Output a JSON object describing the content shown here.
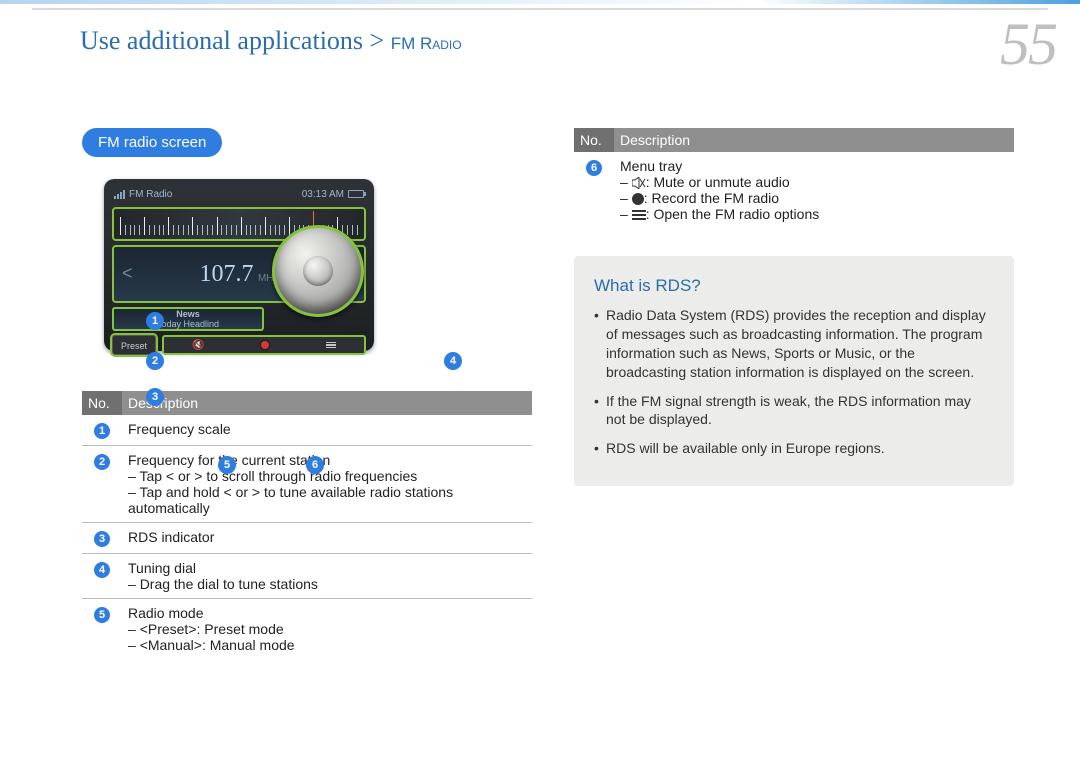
{
  "page": {
    "number": "55",
    "breadcrumb_main": "Use additional applications",
    "breadcrumb_sub": "FM Radio"
  },
  "left": {
    "section_label": "FM radio screen",
    "device": {
      "title": "FM Radio",
      "clock": "03:13 AM",
      "frequency": "107.7",
      "unit": "MHz",
      "arrow_left": "<",
      "arrow_right": ">",
      "rds_line1": "News",
      "rds_line2": "Today Headlind",
      "preset_btn": "Preset"
    },
    "markers": {
      "m1": "1",
      "m2": "2",
      "m3": "3",
      "m4": "4",
      "m5": "5",
      "m6": "6"
    },
    "table": {
      "h_no": "No.",
      "h_desc": "Description",
      "rows": [
        {
          "num": "1",
          "main": "Frequency scale"
        },
        {
          "num": "2",
          "main": "Frequency for the current station",
          "bullets": [
            "Tap < or > to scroll through radio frequencies",
            "Tap and hold < or > to tune available radio stations automatically"
          ]
        },
        {
          "num": "3",
          "main": "RDS indicator"
        },
        {
          "num": "4",
          "main": "Tuning dial",
          "bullets": [
            "Drag the dial to tune stations"
          ]
        },
        {
          "num": "5",
          "main": "Radio mode",
          "bullets": [
            "<Preset>: Preset mode",
            "<Manual>: Manual mode"
          ]
        }
      ]
    }
  },
  "right": {
    "table": {
      "h_no": "No.",
      "h_desc": "Description",
      "row6": {
        "num": "6",
        "main": "Menu tray",
        "bullets": {
          "mute": ": Mute or unmute audio",
          "rec": ": Record the FM radio",
          "opts": ": Open the FM radio options"
        }
      }
    },
    "info": {
      "heading": "What is RDS?",
      "items": [
        "Radio Data System (RDS) provides the reception and display of messages such as broadcasting information. The program information such as News, Sports or Music, or the broadcasting station information is displayed on the screen.",
        "If the FM signal strength is weak, the RDS information may not be displayed.",
        "RDS will be available only in Europe regions."
      ]
    }
  }
}
